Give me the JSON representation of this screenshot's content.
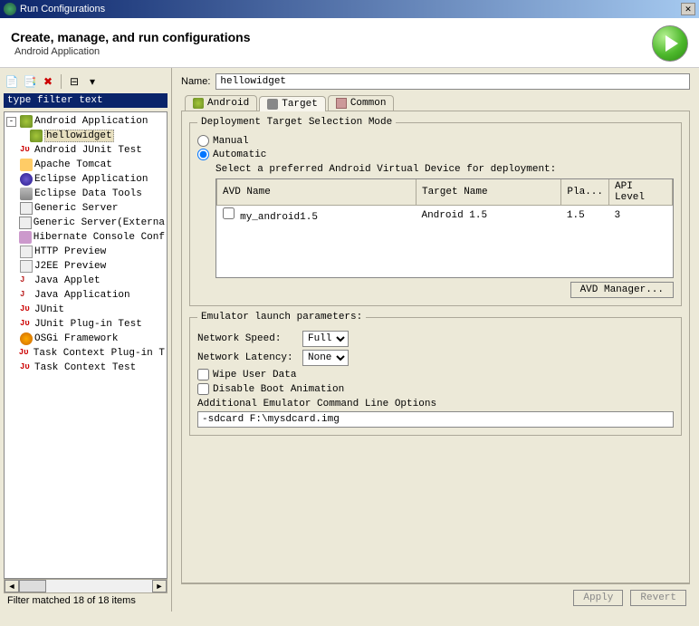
{
  "window": {
    "title": "Run Configurations"
  },
  "header": {
    "title": "Create, manage, and run configurations",
    "subtitle": "Android Application"
  },
  "left": {
    "filter_text": "type filter text",
    "status": "Filter matched 18 of 18 items",
    "tree": {
      "root": "Android Application",
      "root_child": "hellowidget",
      "items": [
        "Android JUnit Test",
        "Apache Tomcat",
        "Eclipse Application",
        "Eclipse Data Tools",
        "Generic Server",
        "Generic Server(Externa",
        "Hibernate Console Conf",
        "HTTP Preview",
        "J2EE Preview",
        "Java Applet",
        "Java Application",
        "JUnit",
        "JUnit Plug-in Test",
        "OSGi Framework",
        "Task Context Plug-in T",
        "Task Context Test"
      ]
    }
  },
  "right": {
    "name_label": "Name:",
    "name_value": "hellowidget",
    "tabs": {
      "android": "Android",
      "target": "Target",
      "common": "Common"
    },
    "target": {
      "groupTitle": "Deployment Target Selection Mode",
      "manual": "Manual",
      "automatic": "Automatic",
      "selectLabel": "Select a preferred Android Virtual Device for deployment:",
      "cols": {
        "avd": "AVD Name",
        "tname": "Target Name",
        "pla": "Pla...",
        "api": "API Level"
      },
      "row": {
        "avd": "my_android1.5",
        "tname": "Android 1.5",
        "pla": "1.5",
        "api": "3"
      },
      "avdmgr": "AVD Manager..."
    },
    "emu": {
      "groupTitle": "Emulator launch parameters:",
      "netspeed_label": "Network Speed:",
      "netspeed_value": "Full",
      "netlatency_label": "Network Latency:",
      "netlatency_value": "None",
      "wipe": "Wipe User Data",
      "noboot": "Disable Boot Animation",
      "cmdlabel": "Additional Emulator Command Line Options",
      "cmdvalue": "-sdcard F:\\mysdcard.img"
    },
    "buttons": {
      "apply": "Apply",
      "revert": "Revert"
    }
  }
}
